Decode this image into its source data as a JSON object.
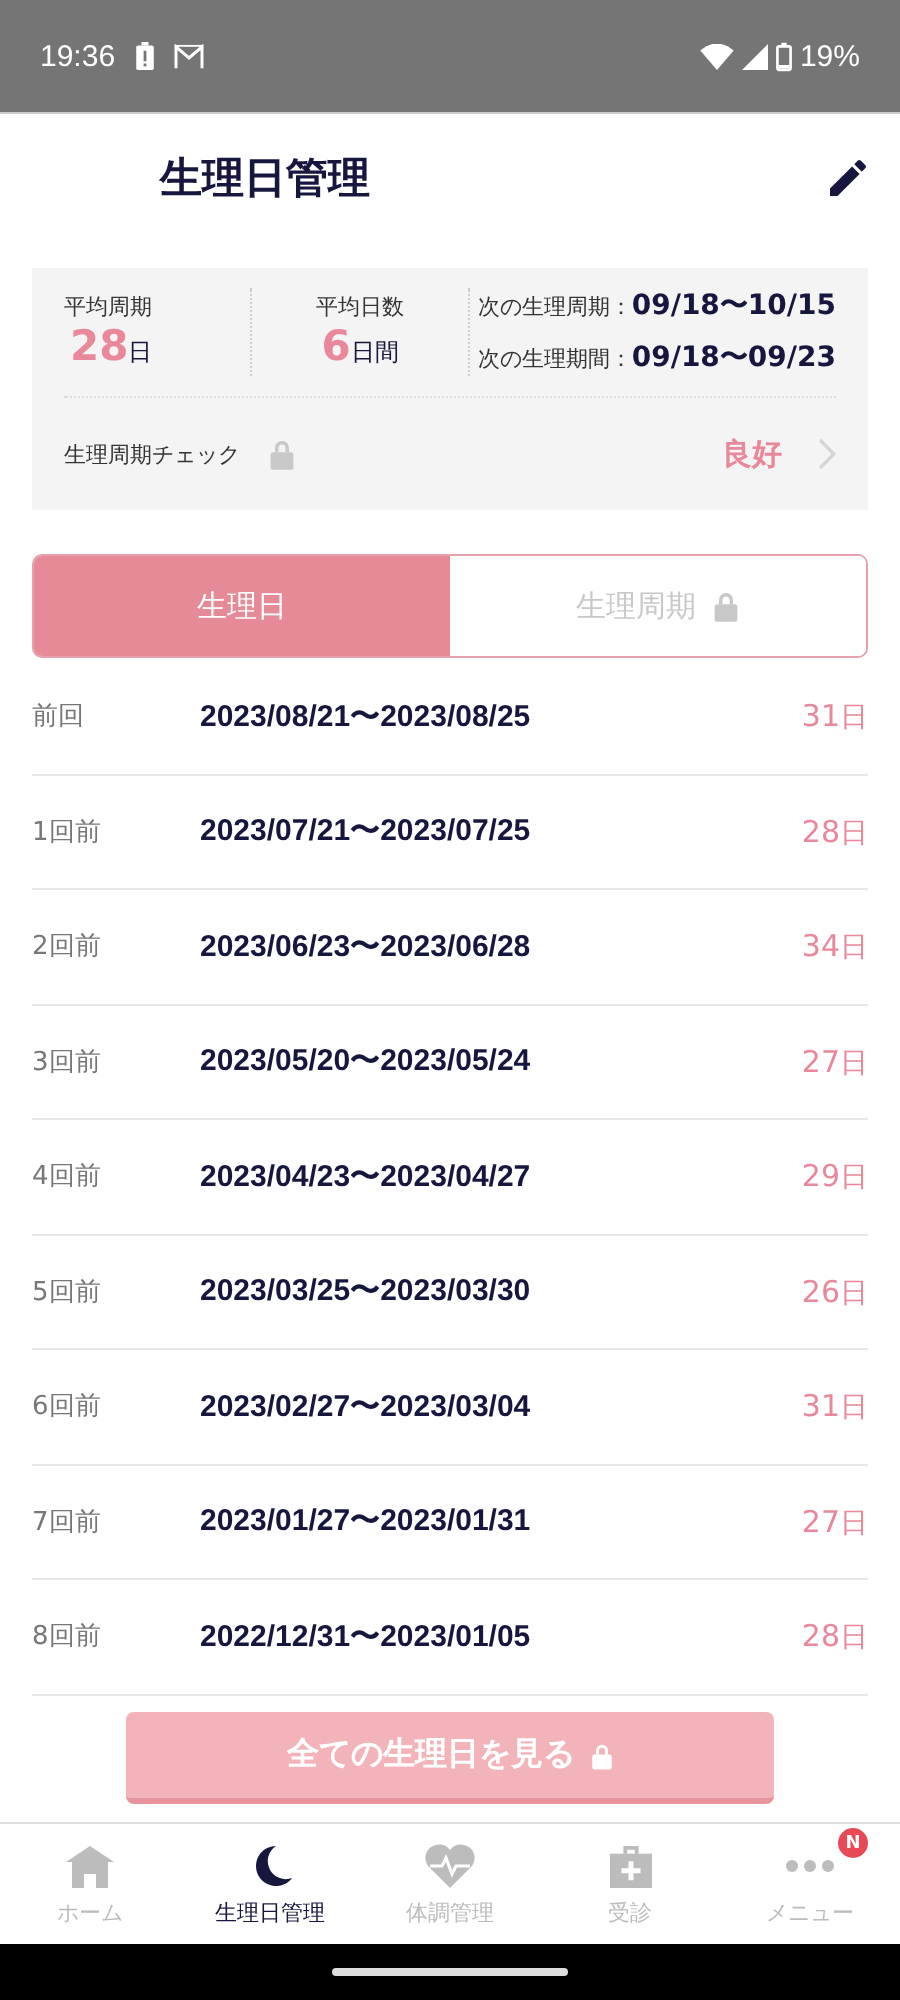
{
  "status_bar": {
    "time": "19:36",
    "battery": "19%"
  },
  "header": {
    "title": "生理日管理"
  },
  "summary": {
    "avg_cycle": {
      "label": "平均周期",
      "value": "28",
      "unit": "日"
    },
    "avg_days": {
      "label": "平均日数",
      "value": "6",
      "unit": "日間"
    },
    "next": [
      {
        "label": "次の生理周期：",
        "value": "09/18〜10/15"
      },
      {
        "label": "次の生理期間：",
        "value": "09/18〜09/23"
      }
    ],
    "check": {
      "label": "生理周期チェック",
      "locked": true,
      "result": "良好"
    }
  },
  "tabs": [
    {
      "label": "生理日",
      "selected": true,
      "locked": false
    },
    {
      "label": "生理周期",
      "selected": false,
      "locked": true
    }
  ],
  "periods": [
    {
      "label": "前回",
      "range": "2023/08/21〜2023/08/25",
      "days": "31",
      "unit": "日"
    },
    {
      "label": "1回前",
      "range": "2023/07/21〜2023/07/25",
      "days": "28",
      "unit": "日"
    },
    {
      "label": "2回前",
      "range": "2023/06/23〜2023/06/28",
      "days": "34",
      "unit": "日"
    },
    {
      "label": "3回前",
      "range": "2023/05/20〜2023/05/24",
      "days": "27",
      "unit": "日"
    },
    {
      "label": "4回前",
      "range": "2023/04/23〜2023/04/27",
      "days": "29",
      "unit": "日"
    },
    {
      "label": "5回前",
      "range": "2023/03/25〜2023/03/30",
      "days": "26",
      "unit": "日"
    },
    {
      "label": "6回前",
      "range": "2023/02/27〜2023/03/04",
      "days": "31",
      "unit": "日"
    },
    {
      "label": "7回前",
      "range": "2023/01/27〜2023/01/31",
      "days": "27",
      "unit": "日"
    },
    {
      "label": "8回前",
      "range": "2022/12/31〜2023/01/05",
      "days": "28",
      "unit": "日"
    }
  ],
  "all_button": {
    "label": "全ての生理日を見る",
    "locked": true,
    "disabled": true
  },
  "bottom_nav": [
    {
      "kind": "home",
      "label": "ホーム",
      "selected": false
    },
    {
      "kind": "moon",
      "label": "生理日管理",
      "selected": true
    },
    {
      "kind": "heart",
      "label": "体調管理",
      "selected": false
    },
    {
      "kind": "medical",
      "label": "受診",
      "selected": false
    },
    {
      "kind": "menu",
      "label": "メニュー",
      "selected": false,
      "badge": "N"
    }
  ]
}
